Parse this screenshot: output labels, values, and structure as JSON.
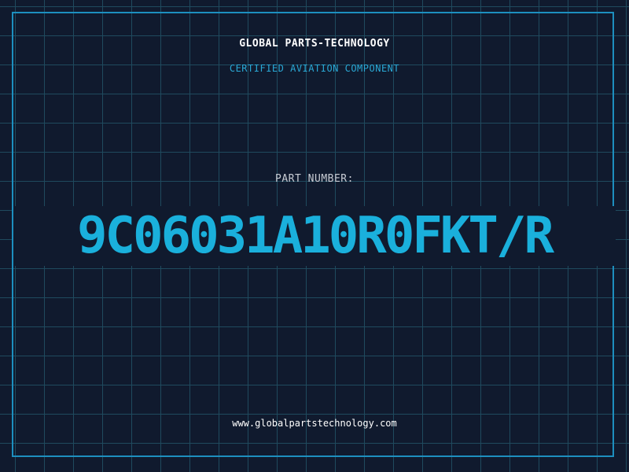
{
  "header": {
    "company": "GLOBAL PARTS-TECHNOLOGY",
    "subtitle": "CERTIFIED AVIATION COMPONENT"
  },
  "part": {
    "label": "PART NUMBER:",
    "number": "9C06031A10R0FKT/R"
  },
  "footer": {
    "website": "www.globalpartstechnology.com"
  },
  "colors": {
    "background": "#101a2e",
    "grid": "#1f4a5e",
    "frame": "#1d8fbf",
    "accent": "#1ab0dc"
  }
}
